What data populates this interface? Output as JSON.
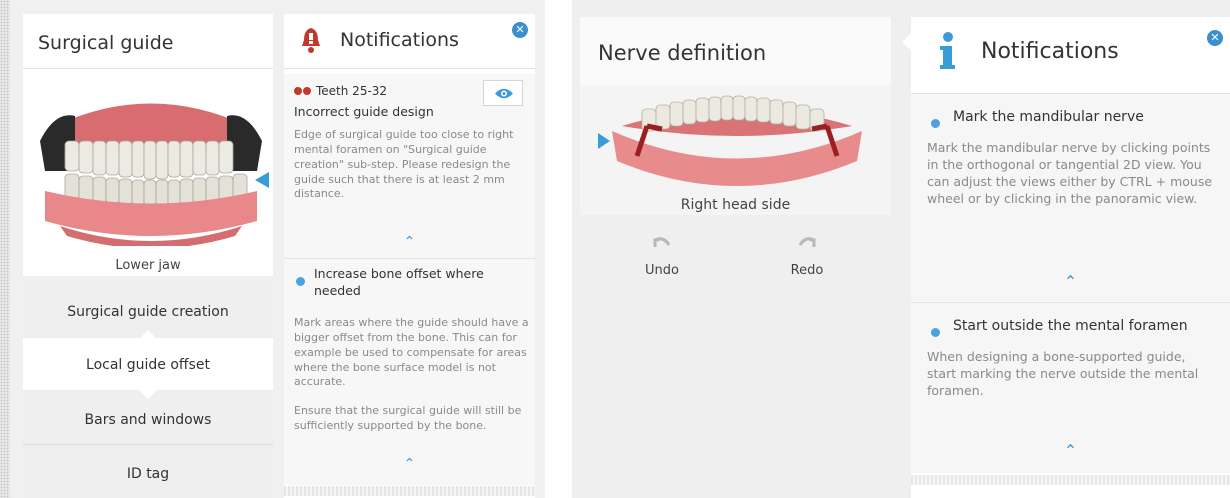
{
  "left": {
    "title": "Surgical guide",
    "model_caption": "Lower jaw",
    "steps": [
      "Surgical guide creation",
      "Local guide offset",
      "Bars and windows",
      "ID tag"
    ],
    "notifications": {
      "header": "Notifications",
      "item1": {
        "teeth_label": "Teeth 25-32",
        "title": "Incorrect guide design",
        "body": "Edge of surgical guide too close to right mental foramen on \"Surgical guide creation\" sub-step. Please redesign the guide such that there is at least 2 mm distance."
      },
      "item2": {
        "title": "Increase bone offset where needed",
        "body": "Mark areas where the guide should have a bigger offset from the bone. This can for example be used to compensate for areas where the bone surface model is not accurate.",
        "body2": "Ensure that the surgical guide will still be sufficiently supported by the bone."
      }
    }
  },
  "right": {
    "title": "Nerve definition",
    "model_caption": "Right head side",
    "undo_label": "Undo",
    "redo_label": "Redo",
    "notifications": {
      "header": "Notifications",
      "item1": {
        "title": "Mark the mandibular nerve",
        "body": "Mark the mandibular nerve by clicking points in the orthogonal or tangential 2D view. You can adjust the views either by CTRL + mouse wheel or by clicking in the panoramic view."
      },
      "item2": {
        "title": "Start outside the mental foramen",
        "body": "When designing a bone-supported guide, start marking the nerve outside the mental foramen."
      }
    }
  },
  "colors": {
    "accent_blue": "#3a9bd9",
    "alert_red": "#c0392b",
    "gum_pink": "#e8888a",
    "tooth": "#e9e7dd"
  },
  "icons": [
    "bell-alert-icon",
    "info-icon",
    "close-icon",
    "eye-icon",
    "chevron-up-icon",
    "undo-icon",
    "redo-icon"
  ]
}
